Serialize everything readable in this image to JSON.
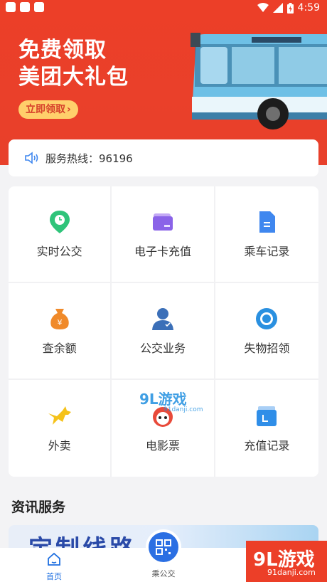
{
  "status_bar": {
    "time": "4:59"
  },
  "promo": {
    "title_line1": "免费领取",
    "title_line2": "美团大礼包",
    "button_label": "立即领取"
  },
  "hotline": {
    "text": "服务热线：96196"
  },
  "grid": {
    "items": [
      {
        "label": "实时公交",
        "icon": "location-pin-icon",
        "color": "#2fc47a"
      },
      {
        "label": "电子卡充值",
        "icon": "card-icon",
        "color": "#8a63e8"
      },
      {
        "label": "乘车记录",
        "icon": "document-icon",
        "color": "#3f87ef"
      },
      {
        "label": "查余额",
        "icon": "money-bag-icon",
        "color": "#f08a2a"
      },
      {
        "label": "公交业务",
        "icon": "person-icon",
        "color": "#3b6fb8"
      },
      {
        "label": "失物招领",
        "icon": "eye-icon",
        "color": "#2a90e0"
      },
      {
        "label": "外卖",
        "icon": "kangaroo-icon",
        "color": "#f5c21a"
      },
      {
        "label": "电影票",
        "icon": "ticket-icon",
        "color": "#e84a3a"
      },
      {
        "label": "充值记录",
        "icon": "recharge-record-icon",
        "color": "#2f8ee8"
      }
    ]
  },
  "news": {
    "section_title": "资讯服务",
    "banner_text": "定制线路"
  },
  "bottom_nav": {
    "home_label": "首页",
    "ride_label": "乘公交"
  },
  "watermark": {
    "corner_big": "9L游戏",
    "corner_small": "91danji.com",
    "center_big": "9L游戏",
    "center_small": "91danji.com"
  },
  "colors": {
    "primary_red": "#ec3f28",
    "accent_blue": "#2b6fe3"
  }
}
